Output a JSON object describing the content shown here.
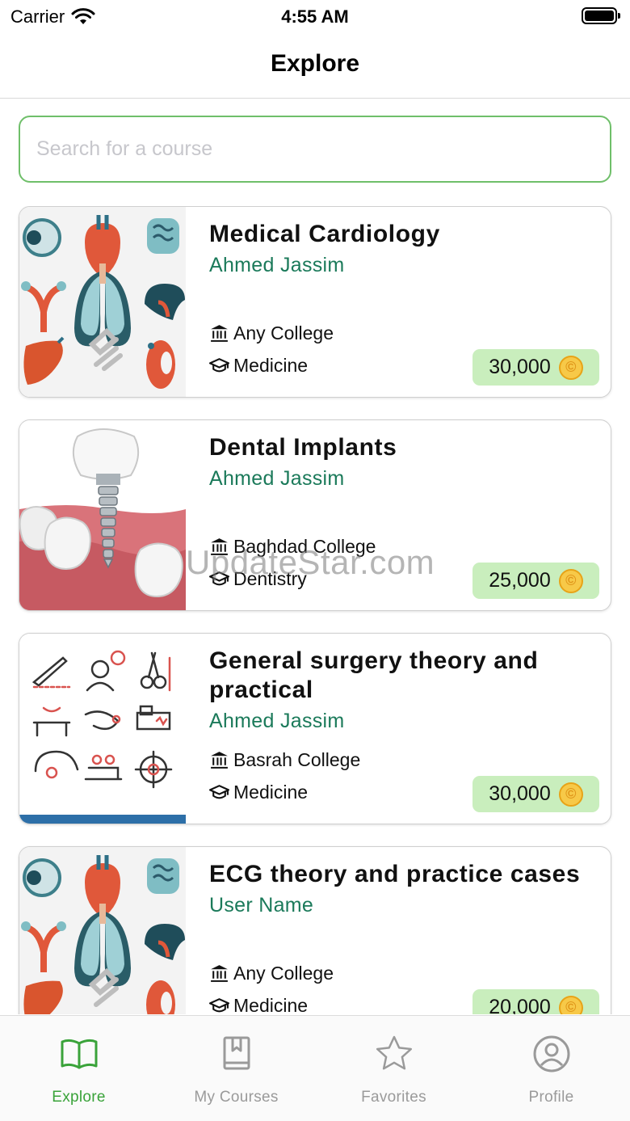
{
  "status_bar": {
    "carrier": "Carrier",
    "time": "4:55 AM"
  },
  "nav": {
    "title": "Explore"
  },
  "search": {
    "placeholder": "Search for a course"
  },
  "courses": [
    {
      "title": "Medical Cardiology",
      "author": "Ahmed Jassim",
      "college": "Any College",
      "department": "Medicine",
      "price": "30,000",
      "thumbnail": "anatomy-organs-illustration"
    },
    {
      "title": "Dental Implants",
      "author": "Ahmed Jassim",
      "college": "Baghdad College",
      "department": "Dentistry",
      "price": "25,000",
      "thumbnail": "dental-implant-illustration"
    },
    {
      "title": "General surgery theory and practical",
      "author": "Ahmed Jassim",
      "college": "Basrah College",
      "department": "Medicine",
      "price": "30,000",
      "thumbnail": "surgery-icons-illustration"
    },
    {
      "title": "ECG theory and practice cases",
      "author": "User Name",
      "college": "Any College",
      "department": "Medicine",
      "price": "20,000",
      "thumbnail": "anatomy-organs-illustration"
    }
  ],
  "watermark": "UpdateStar.com",
  "tabs": [
    {
      "label": "Explore",
      "icon": "book-open-icon",
      "active": true
    },
    {
      "label": "My Courses",
      "icon": "bookmark-book-icon",
      "active": false
    },
    {
      "label": "Favorites",
      "icon": "star-icon",
      "active": false
    },
    {
      "label": "Profile",
      "icon": "user-circle-icon",
      "active": false
    }
  ],
  "colors": {
    "accent": "#3aa33a",
    "search_border": "#6fbf6a",
    "author": "#1b7a5a",
    "price_badge": "#c9eebd",
    "coin": "#f7c948"
  }
}
